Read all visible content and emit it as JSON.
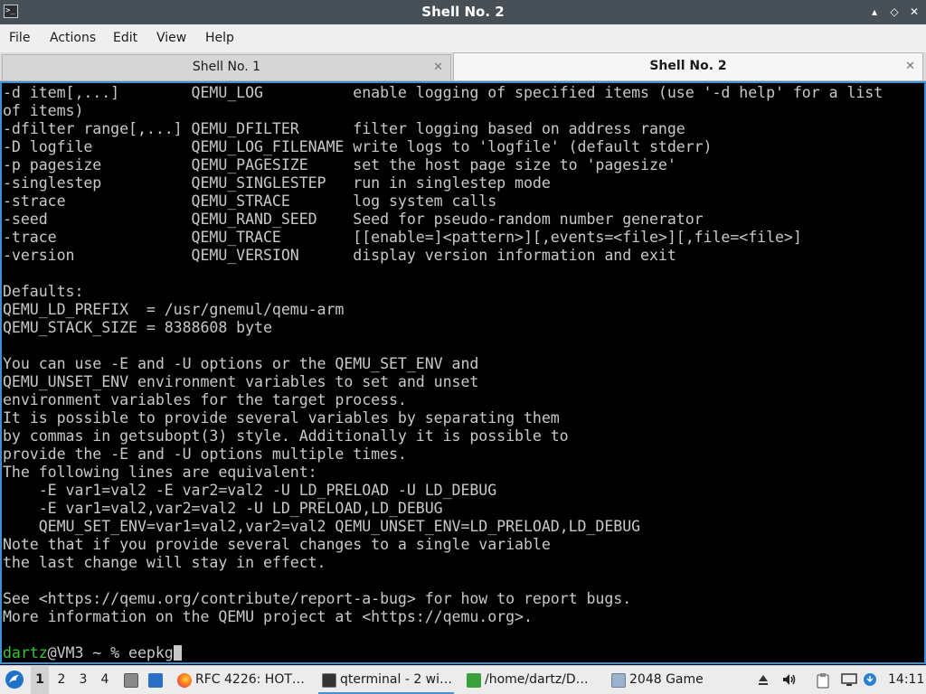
{
  "window": {
    "title": "Shell No. 2",
    "controls": {
      "minimize": "▴",
      "maximize": "◇",
      "close": "✕"
    }
  },
  "menu": [
    "File",
    "Actions",
    "Edit",
    "View",
    "Help"
  ],
  "tabs": [
    {
      "label": "Shell No. 1",
      "close": "✕"
    },
    {
      "label": "Shell No. 2",
      "close": "✕"
    }
  ],
  "terminal": {
    "lines": [
      "-d item[,...]        QEMU_LOG          enable logging of specified items (use '-d help' for a list",
      "of items)",
      "-dfilter range[,...] QEMU_DFILTER      filter logging based on address range",
      "-D logfile           QEMU_LOG_FILENAME write logs to 'logfile' (default stderr)",
      "-p pagesize          QEMU_PAGESIZE     set the host page size to 'pagesize'",
      "-singlestep          QEMU_SINGLESTEP   run in singlestep mode",
      "-strace              QEMU_STRACE       log system calls",
      "-seed                QEMU_RAND_SEED    Seed for pseudo-random number generator",
      "-trace               QEMU_TRACE        [[enable=]<pattern>][,events=<file>][,file=<file>]",
      "-version             QEMU_VERSION      display version information and exit",
      "",
      "Defaults:",
      "QEMU_LD_PREFIX  = /usr/gnemul/qemu-arm",
      "QEMU_STACK_SIZE = 8388608 byte",
      "",
      "You can use -E and -U options or the QEMU_SET_ENV and",
      "QEMU_UNSET_ENV environment variables to set and unset",
      "environment variables for the target process.",
      "It is possible to provide several variables by separating them",
      "by commas in getsubopt(3) style. Additionally it is possible to",
      "provide the -E and -U options multiple times.",
      "The following lines are equivalent:",
      "    -E var1=val2 -E var2=val2 -U LD_PRELOAD -U LD_DEBUG",
      "    -E var1=val2,var2=val2 -U LD_PRELOAD,LD_DEBUG",
      "    QEMU_SET_ENV=var1=val2,var2=val2 QEMU_UNSET_ENV=LD_PRELOAD,LD_DEBUG",
      "Note that if you provide several changes to a single variable",
      "the last change will stay in effect.",
      "",
      "See <https://qemu.org/contribute/report-a-bug> for how to report bugs.",
      "More information on the QEMU project at <https://qemu.org>.",
      ""
    ],
    "prompt": {
      "user": "dartz",
      "host_path": "@VM3 ~ % ",
      "command": "eepkg"
    }
  },
  "taskbar": {
    "workspaces": [
      "1",
      "2",
      "3",
      "4"
    ],
    "tasks": [
      {
        "label": "RFC 4226: HOT…",
        "icon": "firefox-icon"
      },
      {
        "label": "qterminal - 2 wi…",
        "icon": "terminal-icon"
      },
      {
        "label": "/home/dartz/D…",
        "icon": "folder-icon"
      },
      {
        "label": "2048 Game",
        "icon": "window-icon"
      }
    ],
    "clock": "14:11"
  },
  "colors": {
    "titlebar": "#475057",
    "prompt_user": "#39c439",
    "terminal_text": "#c8c8c8",
    "focus_border": "#3b8fd6"
  }
}
